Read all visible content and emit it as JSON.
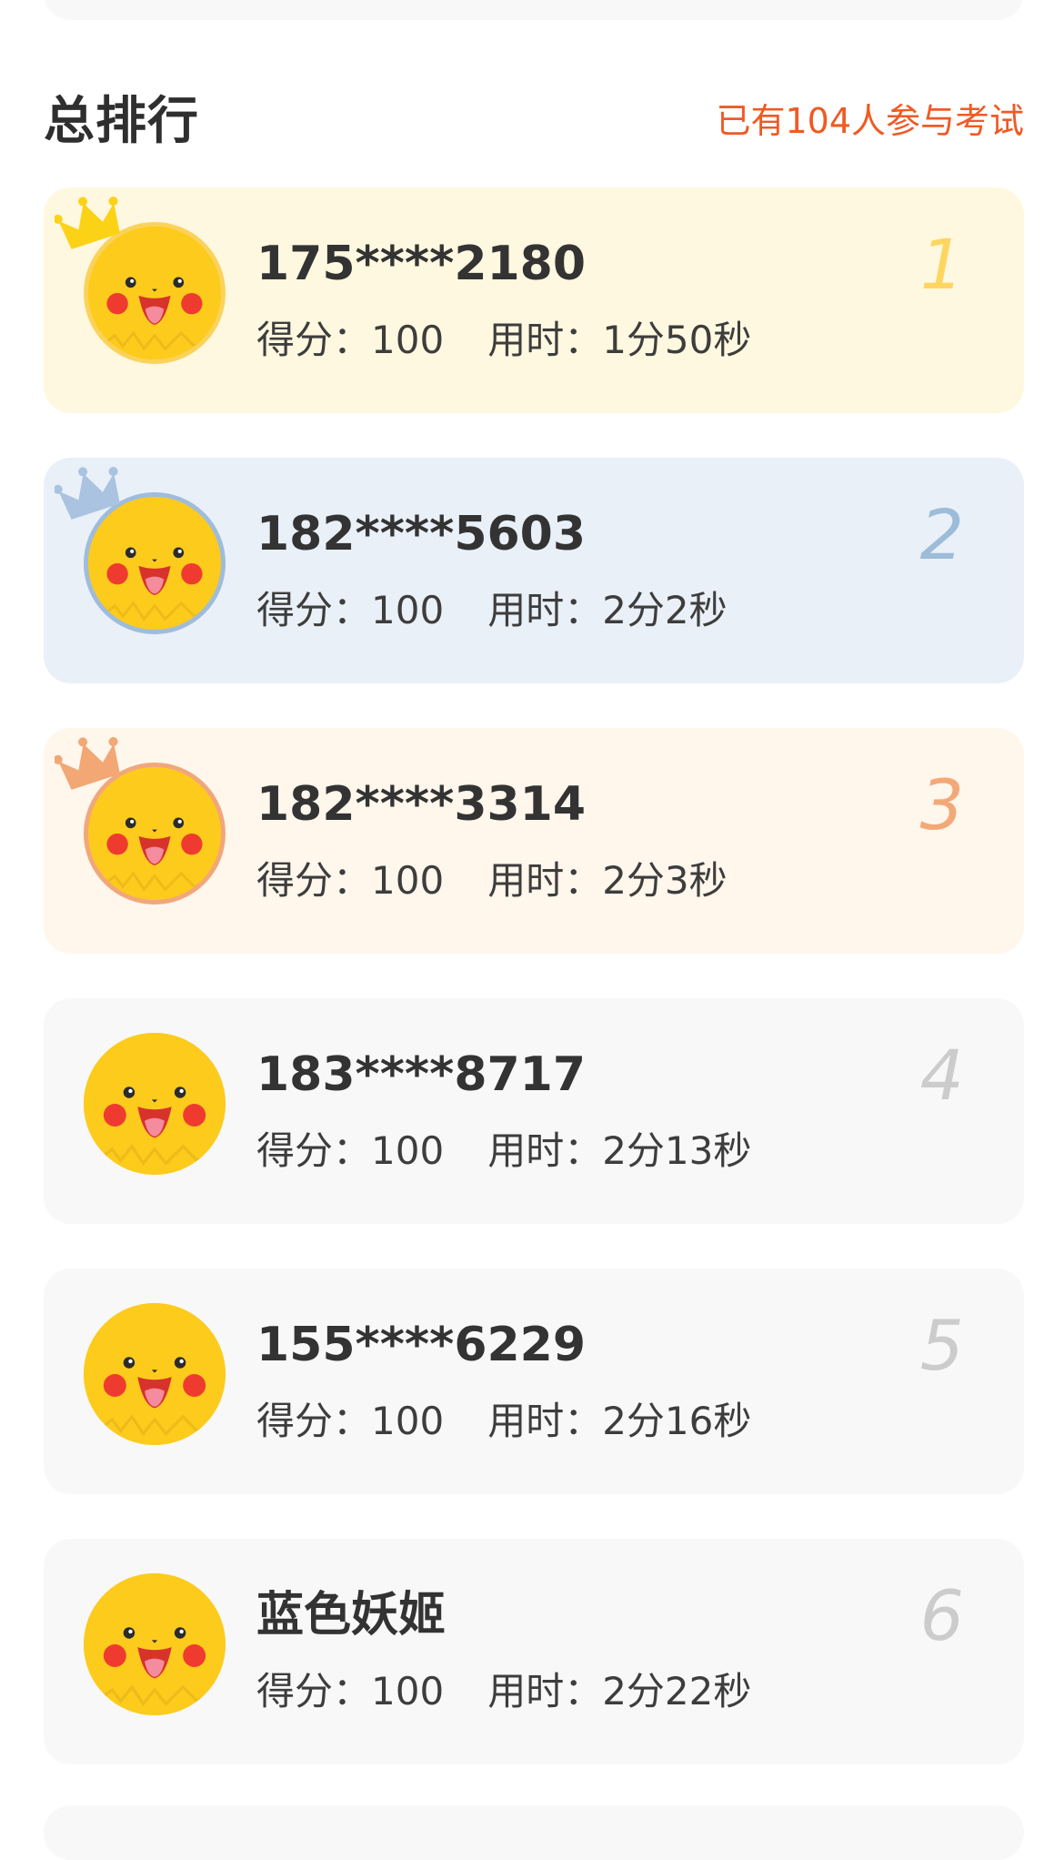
{
  "section": {
    "title": "总排行",
    "participants": "已有104人参与考试"
  },
  "labels": {
    "score": "得分：",
    "time": "用时："
  },
  "colors": {
    "accent_orange": "#ef5a25",
    "gold": "#fdd661",
    "silver": "#9dbcd9",
    "bronze": "#f3a878",
    "default_rank": "#cccccc"
  },
  "ranking": [
    {
      "rank": "1",
      "name": "175****2180",
      "score": "100",
      "time": "1分50秒",
      "crown": "gold-crown-icon"
    },
    {
      "rank": "2",
      "name": "182****5603",
      "score": "100",
      "time": "2分2秒",
      "crown": "silver-crown-icon"
    },
    {
      "rank": "3",
      "name": "182****3314",
      "score": "100",
      "time": "2分3秒",
      "crown": "bronze-crown-icon"
    },
    {
      "rank": "4",
      "name": "183****8717",
      "score": "100",
      "time": "2分13秒"
    },
    {
      "rank": "5",
      "name": "155****6229",
      "score": "100",
      "time": "2分16秒"
    },
    {
      "rank": "6",
      "name": "蓝色妖姬",
      "score": "100",
      "time": "2分22秒"
    }
  ]
}
